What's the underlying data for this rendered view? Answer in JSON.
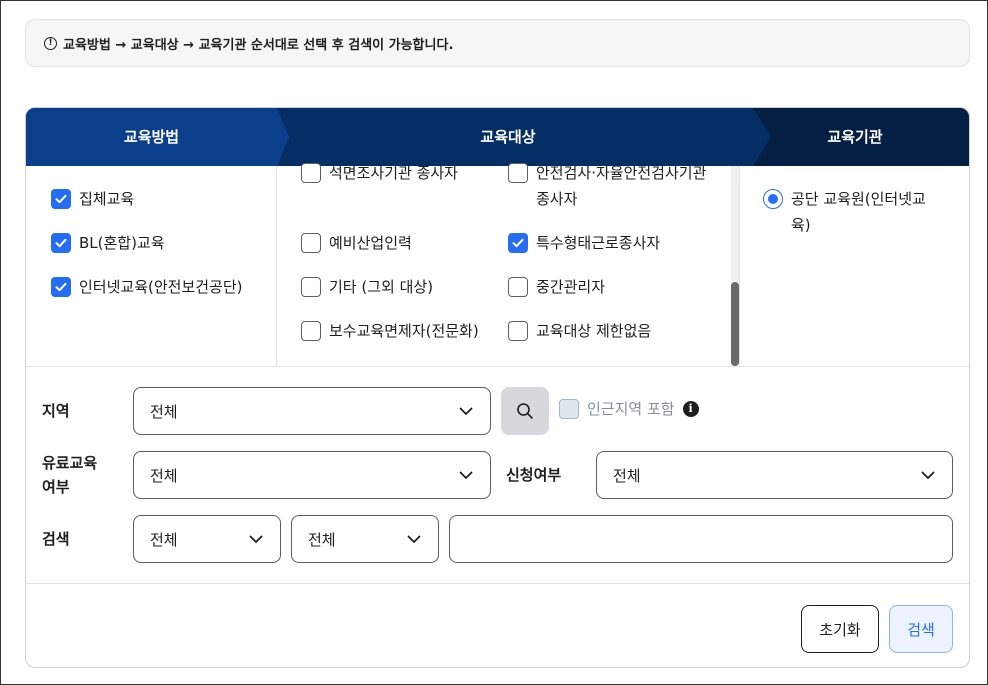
{
  "notice": {
    "icon": "exclamation-circle-icon",
    "text": "교육방법 → 교육대상 → 교육기관 순서대로 선택 후 검색이 가능합니다."
  },
  "steps": {
    "colors": {
      "step1": "#0b3f8c",
      "step2": "#052e64",
      "step3": "#031f44"
    },
    "labels": [
      "교육방법",
      "교육대상",
      "교육기관"
    ]
  },
  "methods": [
    {
      "label": "집체교육",
      "checked": true
    },
    {
      "label": "BL(혼합)교육",
      "checked": true
    },
    {
      "label": "인터넷교육(안전보건공단)",
      "checked": true
    }
  ],
  "targets": [
    {
      "label": "석면조사기관 종사자",
      "checked": false
    },
    {
      "label": "안전검사·자율안전검사기관 종사자",
      "checked": false
    },
    {
      "label": "예비산업인력",
      "checked": false
    },
    {
      "label": "특수형태근로종사자",
      "checked": true
    },
    {
      "label": "기타 (그외 대상)",
      "checked": false
    },
    {
      "label": "중간관리자",
      "checked": false
    },
    {
      "label": "보수교육면제자(전문화)",
      "checked": false
    },
    {
      "label": "교육대상 제한없음",
      "checked": false
    }
  ],
  "institutions": [
    {
      "label": "공단 교육원(인터넷교육)",
      "selected": true
    }
  ],
  "filters": {
    "region_label": "지역",
    "region_value": "전체",
    "nearby_label": "인근지역 포함",
    "paid_label_line1": "유료교육",
    "paid_label_line2": "여부",
    "paid_value": "전체",
    "apply_label": "신청여부",
    "apply_value": "전체",
    "search_label": "검색",
    "search_type1": "전체",
    "search_type2": "전체",
    "search_text": ""
  },
  "buttons": {
    "reset": "초기화",
    "search": "검색"
  },
  "accent": "#256ef4"
}
